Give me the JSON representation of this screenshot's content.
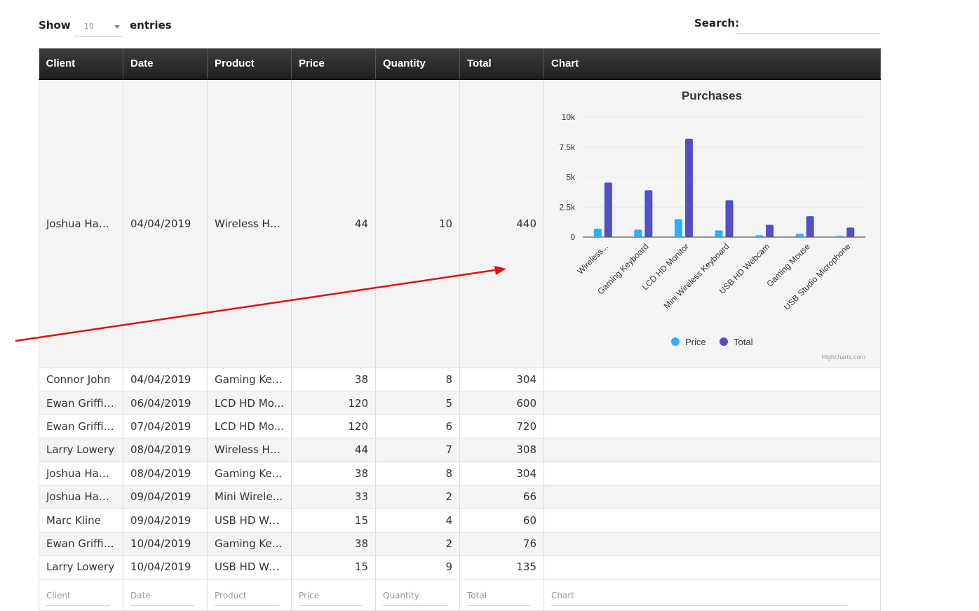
{
  "controls": {
    "show_label": "Show",
    "length_value": "10",
    "entries_label": "entries",
    "search_label": "Search:",
    "search_value": ""
  },
  "table": {
    "headers": [
      "Client",
      "Date",
      "Product",
      "Price",
      "Quantity",
      "Total",
      "Chart"
    ],
    "rows": [
      [
        "Joshua Ham...",
        "04/04/2019",
        "Wireless He...",
        "44",
        "10",
        "440"
      ],
      [
        "Connor John",
        "04/04/2019",
        "Gaming Key...",
        "38",
        "8",
        "304"
      ],
      [
        "Ewan Griffiths",
        "06/04/2019",
        "LCD HD Mo...",
        "120",
        "5",
        "600"
      ],
      [
        "Ewan Griffiths",
        "07/04/2019",
        "LCD HD Mo...",
        "120",
        "6",
        "720"
      ],
      [
        "Larry Lowery",
        "08/04/2019",
        "Wireless He...",
        "44",
        "7",
        "308"
      ],
      [
        "Joshua Ham...",
        "08/04/2019",
        "Gaming Key...",
        "38",
        "8",
        "304"
      ],
      [
        "Joshua Ham...",
        "09/04/2019",
        "Mini Wirele...",
        "33",
        "2",
        "66"
      ],
      [
        "Marc Kline",
        "09/04/2019",
        "USB HD We...",
        "15",
        "4",
        "60"
      ],
      [
        "Ewan Griffiths",
        "10/04/2019",
        "Gaming Key...",
        "38",
        "2",
        "76"
      ],
      [
        "Larry Lowery",
        "10/04/2019",
        "USB HD We...",
        "15",
        "9",
        "135"
      ]
    ],
    "footer_placeholders": [
      "Client",
      "Date",
      "Product",
      "Price",
      "Quantity",
      "Total",
      "Chart"
    ]
  },
  "chart_data": {
    "type": "bar",
    "title": "Purchases",
    "categories": [
      "Wireless...",
      "Gaming Keyboard",
      "LCD HD Monitor",
      "Mini Wireless Keyboard",
      "USB HD Webcam",
      "Gaming Mouse",
      "USB Studio Microphone"
    ],
    "series": [
      {
        "name": "Price",
        "color": "#2caffe",
        "values": [
          700,
          620,
          1500,
          560,
          150,
          280,
          100
        ]
      },
      {
        "name": "Total",
        "color": "#544fc5",
        "values": [
          4550,
          3900,
          8200,
          3080,
          1020,
          1750,
          800
        ]
      }
    ],
    "ylim": [
      0,
      10000
    ],
    "yticks": [
      "0",
      "2.5k",
      "5k",
      "7.5k",
      "10k"
    ],
    "ytick_values": [
      0,
      2500,
      5000,
      7500,
      10000
    ],
    "legend_position": "bottom-center",
    "grid": true,
    "credits": "Highcharts.com"
  },
  "annotation": {
    "color": "#e01010"
  }
}
